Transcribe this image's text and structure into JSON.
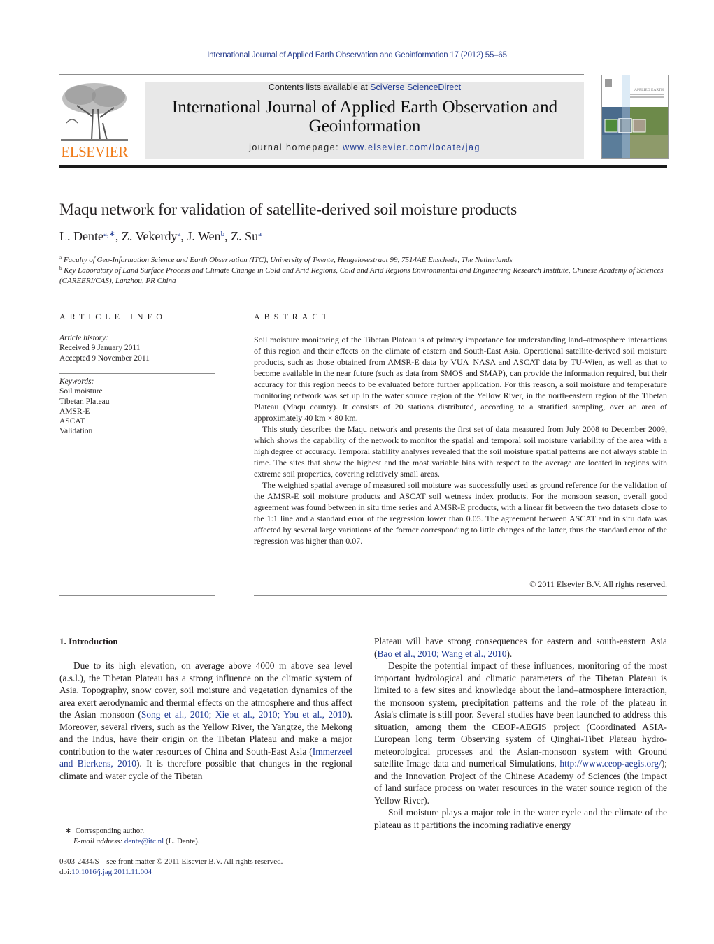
{
  "running_head": "International Journal of Applied Earth Observation and Geoinformation 17 (2012) 55–65",
  "masthead": {
    "publisher_logo": "ELSEVIER",
    "contents_prefix": "Contents lists available at ",
    "contents_link": "SciVerse ScienceDirect",
    "journal_title": "International Journal of Applied Earth Observation and Geoinformation",
    "homepage_prefix": "journal homepage: ",
    "homepage_link": "www.elsevier.com/locate/jag",
    "cover_title": "APPLIED EARTH OBSERVATION AND GEOINFORMATION"
  },
  "article": {
    "title": "Maqu network for validation of satellite-derived soil moisture products",
    "authors": [
      {
        "name": "L. Dente",
        "marks": "a,∗"
      },
      {
        "name": "Z. Vekerdy",
        "marks": "a"
      },
      {
        "name": "J. Wen",
        "marks": "b"
      },
      {
        "name": "Z. Su",
        "marks": "a"
      }
    ],
    "affiliations": [
      {
        "mark": "a",
        "text": "Faculty of Geo-Information Science and Earth Observation (ITC), University of Twente, Hengelosestraat 99, 7514AE Enschede, The Netherlands"
      },
      {
        "mark": "b",
        "text": "Key Laboratory of Land Surface Process and Climate Change in Cold and Arid Regions, Cold and Arid Regions Environmental and Engineering Research Institute, Chinese Academy of Sciences (CAREERI/CAS), Lanzhou, PR China"
      }
    ]
  },
  "article_info": {
    "heading": "ARTICLE INFO",
    "history_label": "Article history:",
    "received": "Received 9 January 2011",
    "accepted": "Accepted 9 November 2011",
    "keywords_label": "Keywords:",
    "keywords": [
      "Soil moisture",
      "Tibetan Plateau",
      "AMSR-E",
      "ASCAT",
      "Validation"
    ]
  },
  "abstract": {
    "heading": "ABSTRACT",
    "paragraphs": [
      "Soil moisture monitoring of the Tibetan Plateau is of primary importance for understanding land–atmosphere interactions of this region and their effects on the climate of eastern and South-East Asia. Operational satellite-derived soil moisture products, such as those obtained from AMSR-E data by VUA–NASA and ASCAT data by TU-Wien, as well as that to become available in the near future (such as data from SMOS and SMAP), can provide the information required, but their accuracy for this region needs to be evaluated before further application. For this reason, a soil moisture and temperature monitoring network was set up in the water source region of the Yellow River, in the north-eastern region of the Tibetan Plateau (Maqu county). It consists of 20 stations distributed, according to a stratified sampling, over an area of approximately 40 km × 80 km.",
      "This study describes the Maqu network and presents the first set of data measured from July 2008 to December 2009, which shows the capability of the network to monitor the spatial and temporal soil moisture variability of the area with a high degree of accuracy. Temporal stability analyses revealed that the soil moisture spatial patterns are not always stable in time. The sites that show the highest and the most variable bias with respect to the average are located in regions with extreme soil properties, covering relatively small areas.",
      "The weighted spatial average of measured soil moisture was successfully used as ground reference for the validation of the AMSR-E soil moisture products and ASCAT soil wetness index products. For the monsoon season, overall good agreement was found between in situ time series and AMSR-E products, with a linear fit between the two datasets close to the 1:1 line and a standard error of the regression lower than 0.05. The agreement between ASCAT and in situ data was affected by several large variations of the former corresponding to little changes of the latter, thus the standard error of the regression was higher than 0.07."
    ],
    "copyright": "© 2011 Elsevier B.V. All rights reserved."
  },
  "introduction": {
    "heading": "1.  Introduction",
    "left_col": {
      "p1_a": "Due to its high elevation, on average above 4000 m above sea level (a.s.l.), the Tibetan Plateau has a strong influence on the climatic system of Asia. Topography, snow cover, soil moisture and vegetation dynamics of the area exert aerodynamic and thermal effects on the atmosphere and thus affect the Asian monsoon (",
      "p1_ref1": "Song et al., 2010; Xie et al., 2010; You et al., 2010",
      "p1_b": "). Moreover, several rivers, such as the Yellow River, the Yangtze, the Mekong and the Indus, have their origin on the Tibetan Plateau and make a major contribution to the water resources of China and South-East Asia (",
      "p1_ref2": "Immerzeel and Bierkens, 2010",
      "p1_c": "). It is therefore possible that changes in the regional climate and water cycle of the Tibetan"
    },
    "right_col": {
      "p1_a": "Plateau will have strong consequences for eastern and south-eastern Asia (",
      "p1_ref": "Bao et al., 2010; Wang et al., 2010",
      "p1_b": ").",
      "p2_a": "Despite the potential impact of these influences, monitoring of the most important hydrological and climatic parameters of the Tibetan Plateau is limited to a few sites and knowledge about the land–atmosphere interaction, the monsoon system, precipitation patterns and the role of the plateau in Asia's climate is still poor. Several studies have been launched to address this situation, among them the CEOP-AEGIS project (Coordinated ASIA-European long term Observing system of Qinghai-Tibet Plateau hydro-meteorological processes and the Asian-monsoon system with Ground satellite Image data and numerical Simulations, ",
      "p2_link": "http://www.ceop-aegis.org/",
      "p2_b": "); and the Innovation Project of the Chinese Academy of Sciences (the impact of land surface process on water resources in the water source region of the Yellow River).",
      "p3": "Soil moisture plays a major role in the water cycle and the climate of the plateau as it partitions the incoming radiative energy"
    }
  },
  "footnotes": {
    "star": "∗",
    "corresponding": "Corresponding author.",
    "email_label": "E-mail address:",
    "email": "dente@itc.nl",
    "email_suffix": " (L. Dente)."
  },
  "front_matter": {
    "issn_line": "0303-2434/$ – see front matter © 2011 Elsevier B.V. All rights reserved.",
    "doi_prefix": "doi:",
    "doi": "10.1016/j.jag.2011.11.004"
  },
  "colors": {
    "link": "#1f3a93",
    "elsevier_orange": "#f07c1a",
    "masthead_bg": "#e8e8e8"
  }
}
